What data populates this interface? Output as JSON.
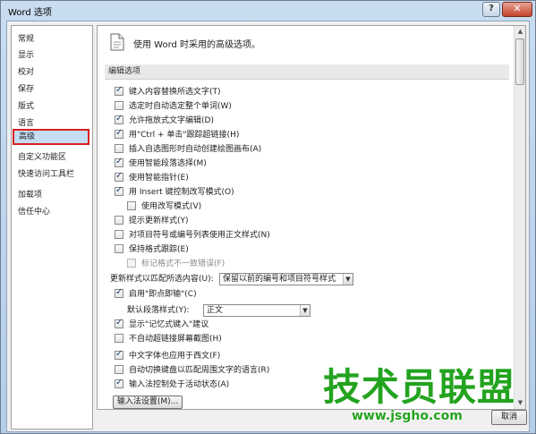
{
  "window": {
    "title": "Word 选项",
    "help": "?",
    "close": "✕"
  },
  "nav": {
    "items": [
      {
        "label": "常规"
      },
      {
        "label": "显示"
      },
      {
        "label": "校对"
      },
      {
        "label": "保存"
      },
      {
        "label": "版式"
      },
      {
        "label": "语言"
      },
      {
        "label": "高级",
        "selected": true
      },
      {
        "label": "自定义功能区"
      },
      {
        "label": "快速访问工具栏"
      },
      {
        "label": "加载项"
      },
      {
        "label": "信任中心"
      }
    ]
  },
  "content": {
    "header": "使用 Word 时采用的高级选项。",
    "section": "编辑选项",
    "options": [
      {
        "label": "键入内容替换所选文字(T)",
        "checked": true
      },
      {
        "label": "选定时自动选定整个单词(W)",
        "checked": false
      },
      {
        "label": "允许拖放式文字编辑(D)",
        "checked": true
      },
      {
        "label": "用\"Ctrl + 单击\"跟踪超链接(H)",
        "checked": true
      },
      {
        "label": "插入自选图形时自动创建绘图画布(A)",
        "checked": false
      },
      {
        "label": "使用智能段落选择(M)",
        "checked": true
      },
      {
        "label": "使用智能指针(E)",
        "checked": true
      },
      {
        "label": "用 Insert 键控制改写模式(O)",
        "checked": true
      },
      {
        "label": "使用改写模式(V)",
        "checked": false,
        "indent": true
      },
      {
        "label": "提示更新样式(Y)",
        "checked": false
      },
      {
        "label": "对项目符号或编号列表使用正文样式(N)",
        "checked": false
      },
      {
        "label": "保持格式跟踪(E)",
        "checked": false
      },
      {
        "label": "标记格式不一致错误(F)",
        "checked": false,
        "indent": true,
        "disabled": true
      }
    ],
    "paste_format": {
      "label": "更新样式以匹配所选内容(U):",
      "value": "保留以前的编号和项目符号样式"
    },
    "click_and_type": {
      "label": "启用\"即点即输\"(C)",
      "checked": true
    },
    "default_para": {
      "label": "默认段落样式(Y):",
      "value": "正文"
    },
    "options2": [
      {
        "label": "显示\"记忆式键入\"建议",
        "checked": true
      },
      {
        "label": "不自动超链接屏幕截图(H)",
        "checked": false
      },
      {
        "label": "中文字体也应用于西文(F)",
        "checked": true
      },
      {
        "label": "自动切换键盘以匹配周围文字的语言(R)",
        "checked": false
      },
      {
        "label": "输入法控制处于活动状态(A)",
        "checked": true
      }
    ],
    "ime_button": "输入法设置(M)..."
  },
  "footer": {
    "cancel": "取消"
  },
  "watermark": {
    "text": "技术员联盟",
    "url": "www.jsgho.com"
  }
}
